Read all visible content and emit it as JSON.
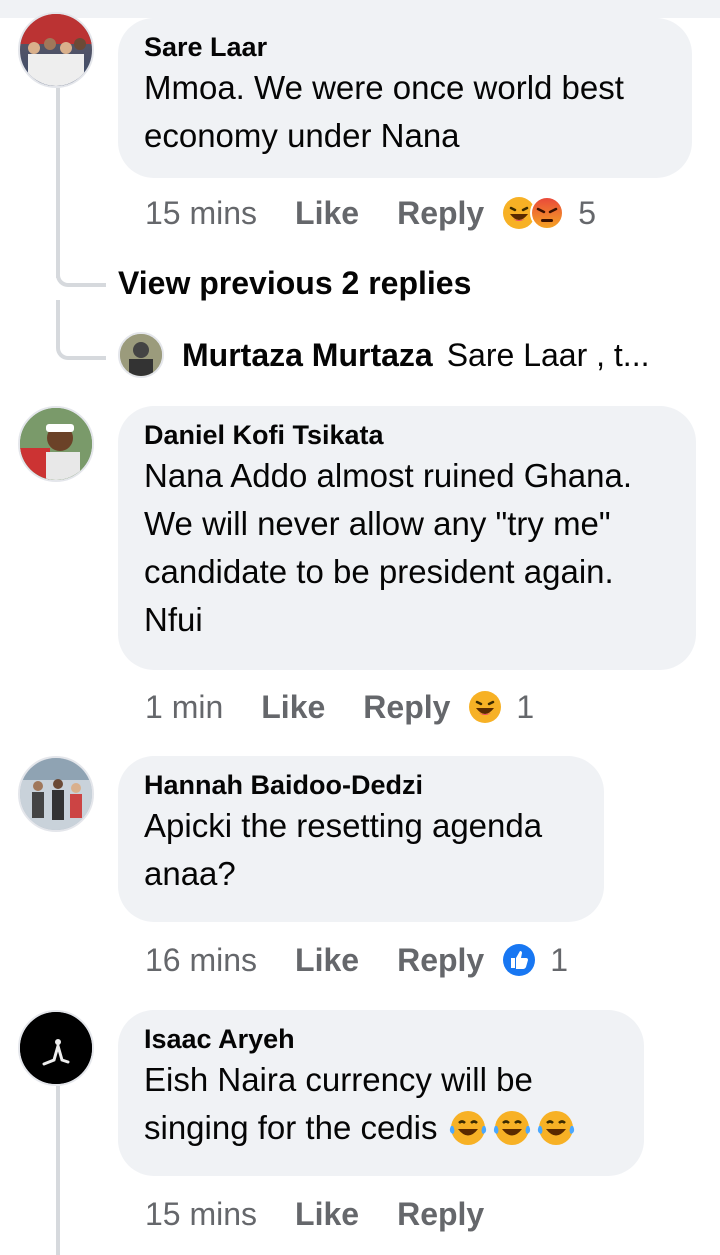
{
  "comments": [
    {
      "author": "Sare Laar",
      "text_lines": [
        "Mmoa. We were once world best",
        "economy under Nana"
      ],
      "time": "15 mins",
      "like": "Like",
      "reply": "Reply",
      "reactions": [
        "haha",
        "angry"
      ],
      "reaction_count": "5"
    },
    {
      "author": "Daniel Kofi Tsikata",
      "text_lines": [
        "Nana Addo almost ruined Ghana.",
        "We will never allow any \"try me\"",
        "candidate to be president again.",
        "Nfui"
      ],
      "time": "1 min",
      "like": "Like",
      "reply": "Reply",
      "reactions": [
        "haha"
      ],
      "reaction_count": "1"
    },
    {
      "author": "Hannah Baidoo-Dedzi",
      "text_lines": [
        "Apicki the resetting agenda",
        "anaa?"
      ],
      "time": "16 mins",
      "like": "Like",
      "reply": "Reply",
      "reactions": [
        "like"
      ],
      "reaction_count": "1"
    },
    {
      "author": "Isaac Aryeh",
      "text_lines": [
        "Eish Naira currency  will be",
        "singing for the cedis"
      ],
      "time": "15 mins",
      "like": "Like",
      "reply": "Reply",
      "inline_emojis": [
        "tears-of-joy",
        "tears-of-joy",
        "tears-of-joy"
      ]
    }
  ],
  "view_previous": "View previous 2 replies",
  "nested_reply": {
    "author": "Murtaza Murtaza",
    "preview": "Sare Laar  , t..."
  },
  "colors": {
    "bubble": "#f0f2f5",
    "meta_text": "#65676b",
    "like_blue": "#1877f2",
    "haha_yellow": "#f7b125",
    "angry_red": "#e9710f"
  }
}
